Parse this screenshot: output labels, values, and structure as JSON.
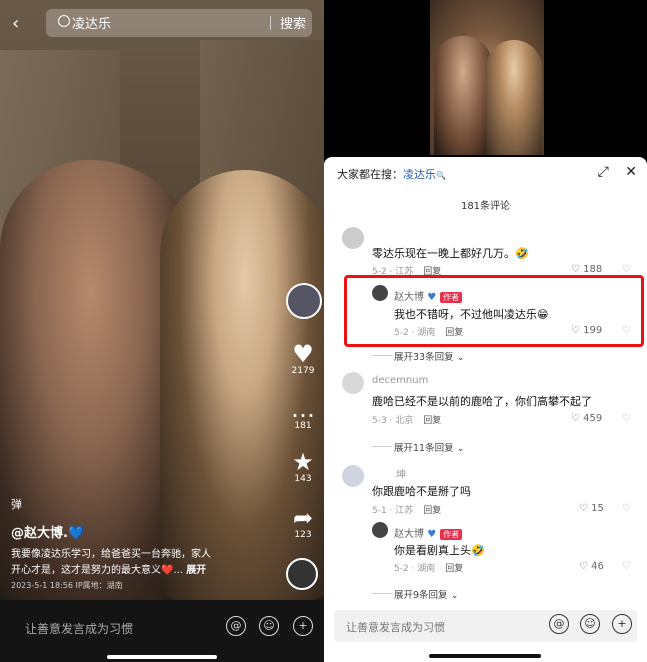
{
  "left_panel": {
    "search_query": "凌达乐",
    "search_button": "搜索",
    "likes": "2179",
    "comments": "181",
    "favorites": "143",
    "shares": "123",
    "music_label": "弹",
    "author": "@赵大博.💙",
    "caption_line1": "我要像凌达乐学习，给爸爸买一台奔驰，家人",
    "caption_line2": "开心才是，这才是努力的最大意义❤️...",
    "expand": "展开",
    "date_location": "2023-5-1 18:56 IP属地：湖南",
    "input_placeholder": "让善意发言成为习惯"
  },
  "right_panel": {
    "trend_prefix": "大家都在搜：",
    "trend_query": "凌达乐",
    "comment_count": "181条评论",
    "comments": [
      {
        "name": "",
        "text": "零达乐现在一晚上都好几万。🤣",
        "meta": "5-2 · 江苏",
        "reply": "回复",
        "likes": "188"
      },
      {
        "name": "赵大博",
        "author_tag": "作者",
        "text": "我也不错呀，不过他叫凌达乐😁",
        "meta": "5-2 · 湖南",
        "reply": "回复",
        "likes": "199",
        "expand": "展开33条回复"
      },
      {
        "name": "decemnum",
        "text": "鹿哈已经不是以前的鹿哈了，你们高攀不起了",
        "meta": "5-3 · 北京",
        "reply": "回复",
        "likes": "459",
        "expand": "展开11条回复"
      },
      {
        "name": "坤",
        "text": "你跟鹿哈不是掰了吗",
        "meta": "5-1 · 江苏",
        "reply": "回复",
        "likes": "15"
      },
      {
        "name": "赵大博",
        "author_tag": "作者",
        "text": "你是看剧真上头🤣",
        "meta": "5-2 · 湖南",
        "reply": "回复",
        "likes": "46",
        "expand": "展开9条回复"
      }
    ],
    "input_placeholder": "让善意发言成为习惯"
  }
}
